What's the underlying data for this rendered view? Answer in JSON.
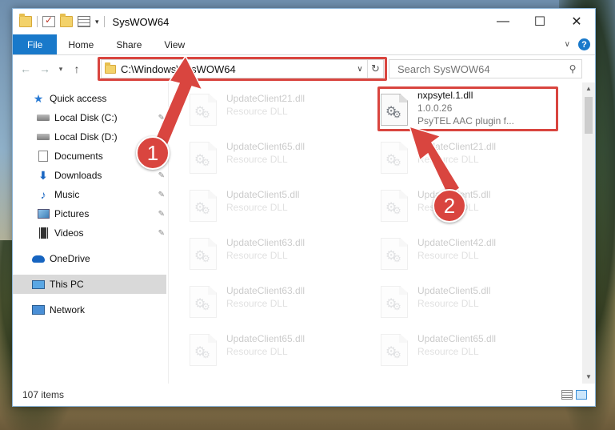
{
  "window": {
    "title": "SysWOW64",
    "controls": {
      "minimize": "—",
      "maximize": "☐",
      "close": "✕"
    }
  },
  "ribbon": {
    "tabs": [
      "File",
      "Home",
      "Share",
      "View"
    ],
    "help": "?"
  },
  "navbar": {
    "back": "←",
    "forward": "→",
    "recent": "▾",
    "up": "↑",
    "address": "C:\\Windows\\SysWOW64",
    "refresh": "↻",
    "search_placeholder": "Search SysWOW64"
  },
  "sidebar": {
    "items": [
      {
        "label": "Quick access",
        "icon": "quick-access-star-icon",
        "pinned": false
      },
      {
        "label": "Local Disk (C:)",
        "icon": "local-disk-icon",
        "pinned": true
      },
      {
        "label": "Local Disk (D:)",
        "icon": "local-disk-icon",
        "pinned": false
      },
      {
        "label": "Documents",
        "icon": "documents-icon",
        "pinned": true
      },
      {
        "label": "Downloads",
        "icon": "downloads-icon",
        "pinned": true
      },
      {
        "label": "Music",
        "icon": "music-icon",
        "pinned": true
      },
      {
        "label": "Pictures",
        "icon": "pictures-icon",
        "pinned": true
      },
      {
        "label": "Videos",
        "icon": "videos-icon",
        "pinned": true
      },
      {
        "label": "OneDrive",
        "icon": "onedrive-cloud-icon",
        "pinned": false
      },
      {
        "label": "This PC",
        "icon": "this-pc-icon",
        "pinned": false,
        "selected": true
      },
      {
        "label": "Network",
        "icon": "network-icon",
        "pinned": false
      }
    ]
  },
  "files": {
    "left": [
      {
        "name": "UpdateClient21.dll",
        "sub": "Resource DLL"
      },
      {
        "name": "UpdateClient65.dll",
        "sub": "Resource DLL"
      },
      {
        "name": "UpdateClient5.dll",
        "sub": "Resource DLL"
      },
      {
        "name": "UpdateClient63.dll",
        "sub": "Resource DLL"
      },
      {
        "name": "UpdateClient63.dll",
        "sub": "Resource DLL"
      },
      {
        "name": "UpdateClient65.dll",
        "sub": "Resource DLL"
      }
    ],
    "right": [
      {
        "name": "nxpsytel.1.dll",
        "sub": "1.0.0.26",
        "sub2": "PsyTEL AAC plugin f...",
        "highlighted": true
      },
      {
        "name": "UpdateClient21.dll",
        "sub": "Resource DLL"
      },
      {
        "name": "UpdateClient5.dll",
        "sub": "Resource DLL"
      },
      {
        "name": "UpdateClient42.dll",
        "sub": "Resource DLL"
      },
      {
        "name": "UpdateClient5.dll",
        "sub": "Resource DLL"
      },
      {
        "name": "UpdateClient65.dll",
        "sub": "Resource DLL"
      }
    ]
  },
  "status": {
    "count": "107 items"
  },
  "annotations": {
    "step1": "1",
    "step2": "2",
    "color": "#d9453f"
  }
}
